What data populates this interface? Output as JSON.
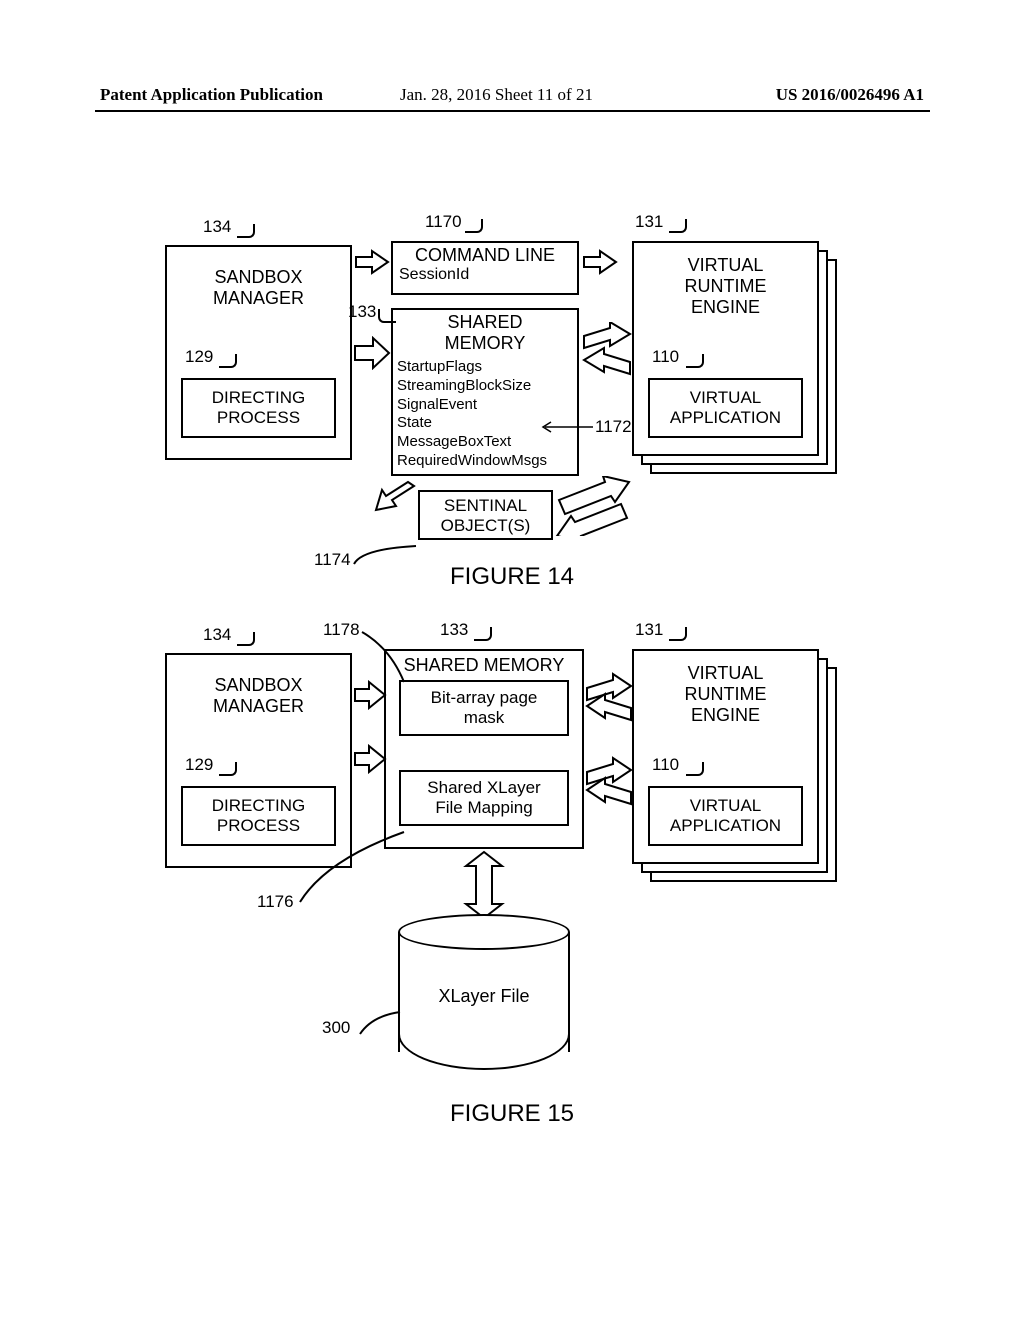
{
  "header": {
    "left": "Patent Application Publication",
    "center": "Jan. 28, 2016  Sheet 11 of 21",
    "right": "US 2016/0026496 A1"
  },
  "fig14": {
    "caption": "FIGURE 14",
    "refs": {
      "r134": "134",
      "r129": "129",
      "r1170": "1170",
      "r133": "133",
      "r1172": "1172",
      "r1174": "1174",
      "r131": "131",
      "r110": "110"
    },
    "boxes": {
      "sandbox": "SANDBOX\nMANAGER",
      "directing": "DIRECTING\nPROCESS",
      "vre": "VIRTUAL\nRUNTIME\nENGINE",
      "vapp": "VIRTUAL\nAPPLICATION",
      "cmdline_title": "COMMAND LINE",
      "cmdline_sub": "SessionId",
      "shared_title": "SHARED\nMEMORY",
      "shared_fields": [
        "StartupFlags",
        "StreamingBlockSize",
        "SignalEvent",
        "State",
        "MessageBoxText",
        "RequiredWindowMsgs"
      ],
      "sentinel": "SENTINAL\nOBJECT(S)"
    }
  },
  "fig15": {
    "caption": "FIGURE 15",
    "refs": {
      "r134": "134",
      "r129": "129",
      "r1178": "1178",
      "r133": "133",
      "r131": "131",
      "r110": "110",
      "r1176": "1176",
      "r300": "300"
    },
    "boxes": {
      "sandbox": "SANDBOX\nMANAGER",
      "directing": "DIRECTING\nPROCESS",
      "vre": "VIRTUAL\nRUNTIME\nENGINE",
      "vapp": "VIRTUAL\nAPPLICATION",
      "shared_title": "SHARED MEMORY",
      "bitarray": "Bit-array page\nmask",
      "xlayermap": "Shared XLayer\nFile Mapping",
      "xlayerfile": "XLayer File"
    }
  }
}
